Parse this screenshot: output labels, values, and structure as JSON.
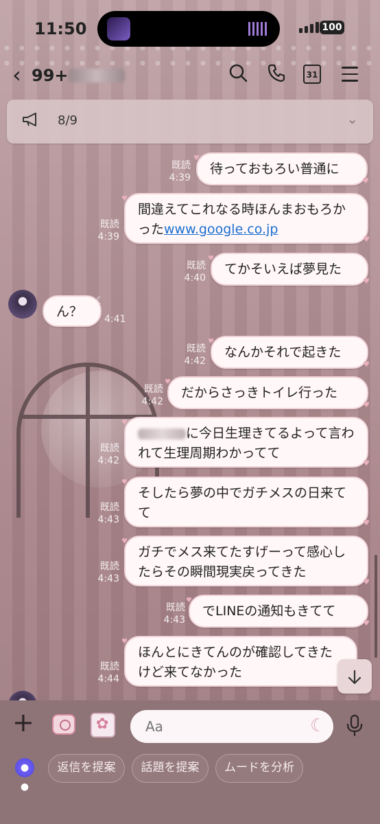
{
  "status_bar": {
    "time": "11:50",
    "battery": "100"
  },
  "header": {
    "back_icon": "chevron-left-icon",
    "unread_count": "99+",
    "calendar_day": "31"
  },
  "announcement": {
    "text": "8/9"
  },
  "messages": [
    {
      "side": "out",
      "text": "待っておもろい普通に",
      "read": "既読",
      "time": "4:39"
    },
    {
      "side": "out",
      "text": "間違えてこれなる時ほんまおもろかった",
      "link": "www.google.co.jp",
      "read": "既読",
      "time": "4:39"
    },
    {
      "side": "out",
      "text": "てかそいえば夢見た",
      "read": "既読",
      "time": "4:40"
    },
    {
      "side": "in",
      "text": "ん？",
      "time": "4:41"
    },
    {
      "side": "out",
      "text": "なんかそれで起きた",
      "read": "既読",
      "time": "4:42"
    },
    {
      "side": "out",
      "text": "だからさっきトイレ行った",
      "read": "既読",
      "time": "4:42"
    },
    {
      "side": "out",
      "text": "に今日生理きてるよって言われて生理周期わかってて",
      "read": "既読",
      "time": "4:42"
    },
    {
      "side": "out",
      "text": "そしたら夢の中でガチメスの日来てて",
      "read": "既読",
      "time": "4:43"
    },
    {
      "side": "out",
      "text": "ガチでメス来てたすげーって感心したらその瞬間現実戻ってきた",
      "read": "既読",
      "time": "4:43"
    },
    {
      "side": "out",
      "text": "でLINEの通知もきてて",
      "read": "既読",
      "time": "4:43"
    },
    {
      "side": "out",
      "text": "ほんとにきてんのが確認してきたけど来てなかった",
      "read": "既読",
      "time": "4:44"
    }
  ],
  "input": {
    "placeholder": "Aa"
  },
  "suggestions": [
    "返信を提案",
    "話題を提案",
    "ムードを分析"
  ],
  "colors": {
    "bubble": "#fff7f8",
    "link": "#1b6fd1",
    "background": "#a9878c"
  }
}
